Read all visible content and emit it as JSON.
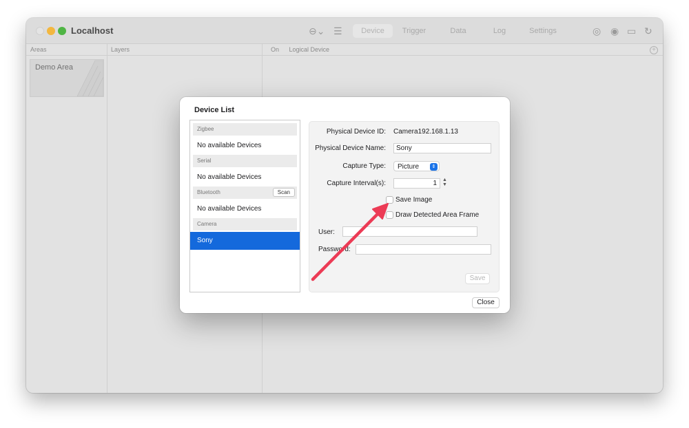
{
  "window": {
    "title": "Localhost",
    "toolbar_tabs": [
      "Device",
      "Trigger",
      "Data",
      "Log",
      "Settings"
    ],
    "icons": [
      "more-icon",
      "list-icon",
      "camera-icon",
      "palette-icon",
      "device-icon",
      "refresh-icon"
    ]
  },
  "columns": {
    "areas": "Areas",
    "layers": "Layers",
    "on": "On",
    "logical_device": "Logical Device"
  },
  "areas": [
    {
      "name": "Demo Area"
    }
  ],
  "dialog": {
    "title": "Device List",
    "sections": [
      {
        "header": "Zigbee",
        "item": "No available Devices"
      },
      {
        "header": "Serial",
        "item": "No available Devices"
      },
      {
        "header": "Bluetooth",
        "item": "No available Devices",
        "action": "Scan"
      },
      {
        "header": "Camera",
        "item": "Sony"
      }
    ],
    "details": {
      "physical_id_label": "Physical Device ID:",
      "physical_id_value": "Camera192.168.1.13",
      "physical_name_label": "Physical Device Name:",
      "physical_name_value": "Sony",
      "capture_type_label": "Capture Type:",
      "capture_type_value": "Picture",
      "capture_interval_label": "Capture Interval(s):",
      "capture_interval_value": "1",
      "save_image_label": "Save Image",
      "draw_frame_label": "Draw Detected Area Frame",
      "user_label": "User:",
      "user_value": "",
      "password_label": "Password:",
      "password_value": "",
      "save_button": "Save"
    },
    "close_button": "Close"
  },
  "colors": {
    "selection": "#1469dc",
    "annotation_arrow": "#ec3b55"
  }
}
